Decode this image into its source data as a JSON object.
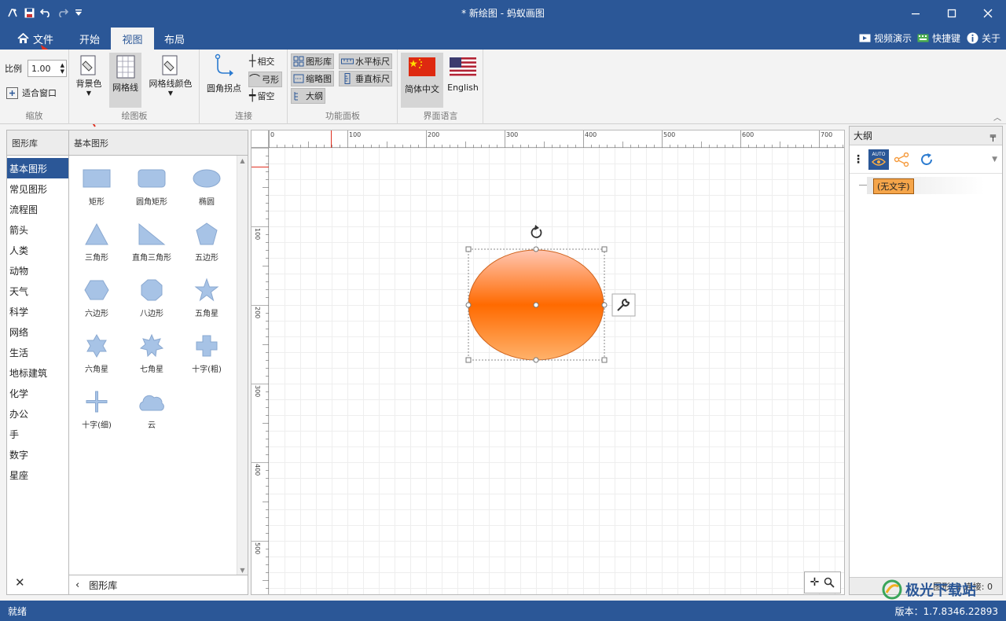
{
  "titlebar": {
    "title": "* 新绘图 - 蚂蚁画图"
  },
  "tabs": {
    "file": "文件",
    "home": "开始",
    "view": "视图",
    "layout": "布局"
  },
  "topright": {
    "video": "视频演示",
    "shortcuts": "快捷键",
    "about": "关于"
  },
  "ribbon": {
    "zoom": {
      "scale_label": "比例",
      "scale_value": "1.00",
      "fit_label": "适合窗口",
      "group": "缩放"
    },
    "canvas": {
      "bg": "背景色",
      "grid": "网格线",
      "grid_color": "网格线颜色",
      "group": "绘图板"
    },
    "connect": {
      "round": "圆角拐点",
      "intersect": "相交",
      "arc": "弓形",
      "gap": "留空",
      "group": "连接"
    },
    "panels": {
      "library": "图形库",
      "thumbnail": "缩略图",
      "outline": "大纲",
      "hruler": "水平标尺",
      "vruler": "垂直标尺",
      "group": "功能面板"
    },
    "lang": {
      "zh": "简体中文",
      "en": "English",
      "group": "界面语言"
    }
  },
  "library": {
    "header": "图形库",
    "shapes_header": "基本图形",
    "categories": [
      "基本图形",
      "常见图形",
      "流程图",
      "箭头",
      "人类",
      "动物",
      "天气",
      "科学",
      "网络",
      "生活",
      "地标建筑",
      "化学",
      "办公",
      "手",
      "数字",
      "星座"
    ],
    "shapes": [
      "矩形",
      "圆角矩形",
      "椭圆",
      "三角形",
      "直角三角形",
      "五边形",
      "六边形",
      "八边形",
      "五角星",
      "六角星",
      "七角星",
      "十字(粗)",
      "十字(细)",
      "云"
    ],
    "footer": "图形库"
  },
  "rulers": {
    "h": [
      "0",
      "100",
      "200",
      "300",
      "400",
      "500",
      "600",
      "700"
    ],
    "v": [
      "100",
      "200",
      "300",
      "400",
      "500"
    ]
  },
  "outline": {
    "title": "大纲",
    "node": "(无文字)",
    "auto": "AUTO",
    "footer": "图形: 1 连接: 0"
  },
  "status": {
    "left": "就绪",
    "version": "版本：1.7.8346.22893",
    "watermark": "极光下载站"
  },
  "colors": {
    "accent": "#2b5797",
    "ellipse_top": "#ffc6b2",
    "ellipse_mid": "#ff6a00",
    "ellipse_bottom": "#ffb26b",
    "shape_fill": "#a7c3e6"
  }
}
